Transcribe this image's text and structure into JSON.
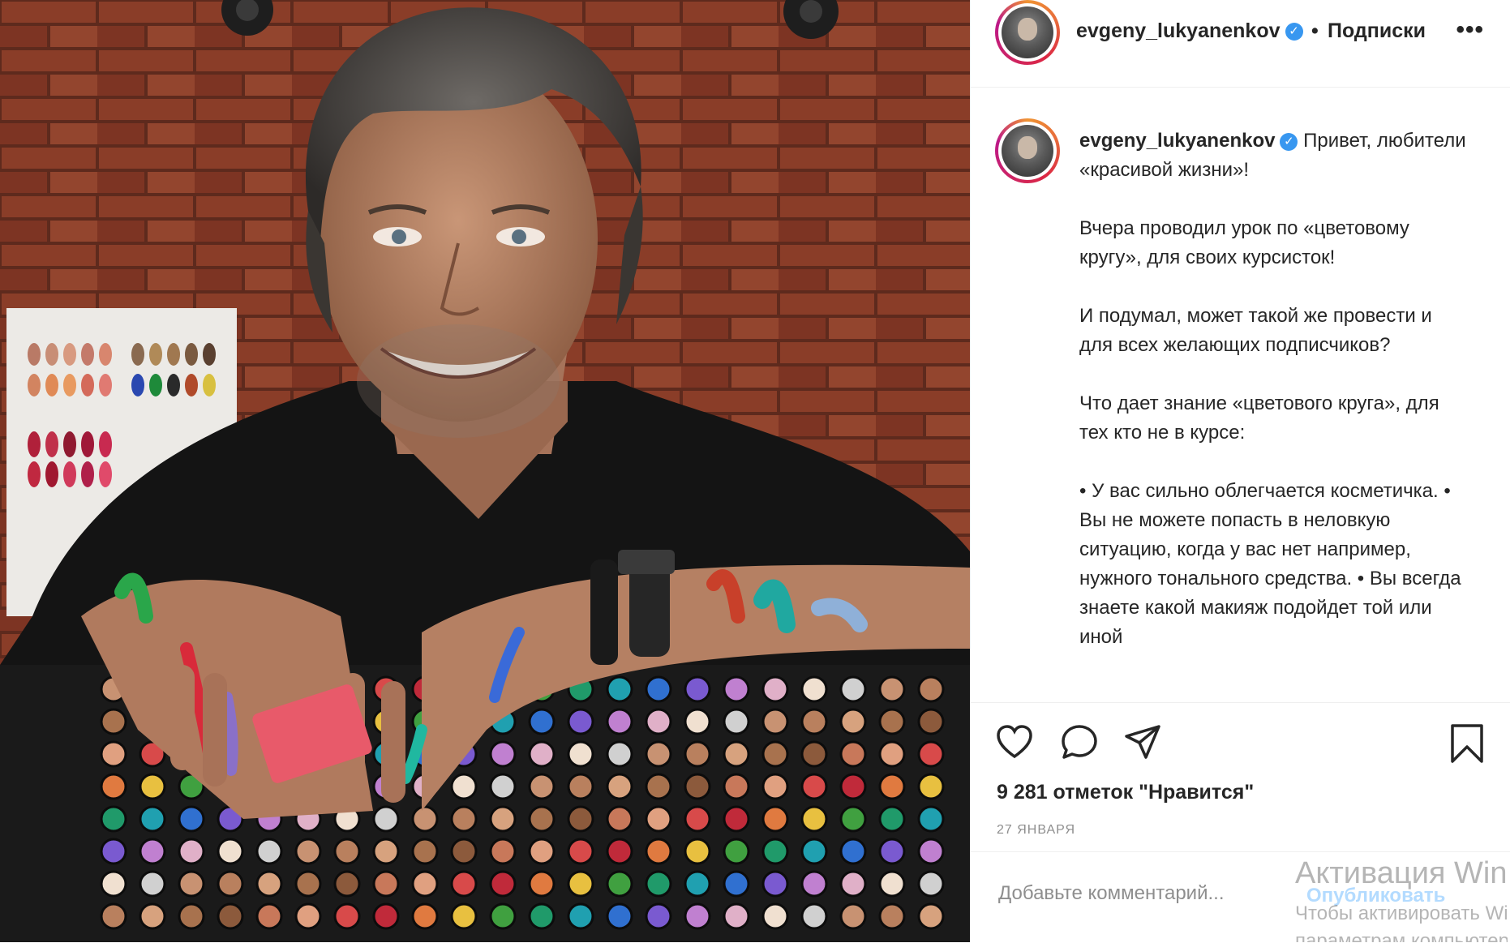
{
  "header": {
    "username": "evgeny_lukyanenkov",
    "separator": "•",
    "follow_label": "Подписки",
    "more_icon": "more-icon"
  },
  "caption": {
    "username": "evgeny_lukyanenkov",
    "paragraphs": [
      "Привет, любители «красивой жизни»!",
      "Вчера проводил урок по «цветовому кругу», для своих курсисток!",
      "И подумал, может такой же провести и для всех желающих подписчиков?",
      "Что дает знание «цветового круга», для тех кто не в курсе:",
      "• У вас сильно облегчается косметичка. • Вы не можете попасть в неловкую ситуацию, когда у вас нет например, нужного тонального средства. • Вы всегда знаете какой макияж подойдет той или иной"
    ]
  },
  "actions": {
    "icons": [
      "heart-icon",
      "comment-icon",
      "share-icon",
      "bookmark-icon"
    ],
    "likes_text": "9 281 отметок \"Нравится\"",
    "date": "27 ЯНВАРЯ"
  },
  "comment": {
    "placeholder": "Добавьте комментарий...",
    "publish_label": "Опубликовать"
  },
  "watermark": {
    "title": "Активация Windows",
    "subtitle_line1": "Чтобы активировать Windows, перейдите к",
    "subtitle_line2": "параметрам компьютера."
  },
  "colors": {
    "verified": "#3897f0",
    "publish": "#b3dbff",
    "text": "#262626",
    "secondary": "#8e8e8e"
  }
}
